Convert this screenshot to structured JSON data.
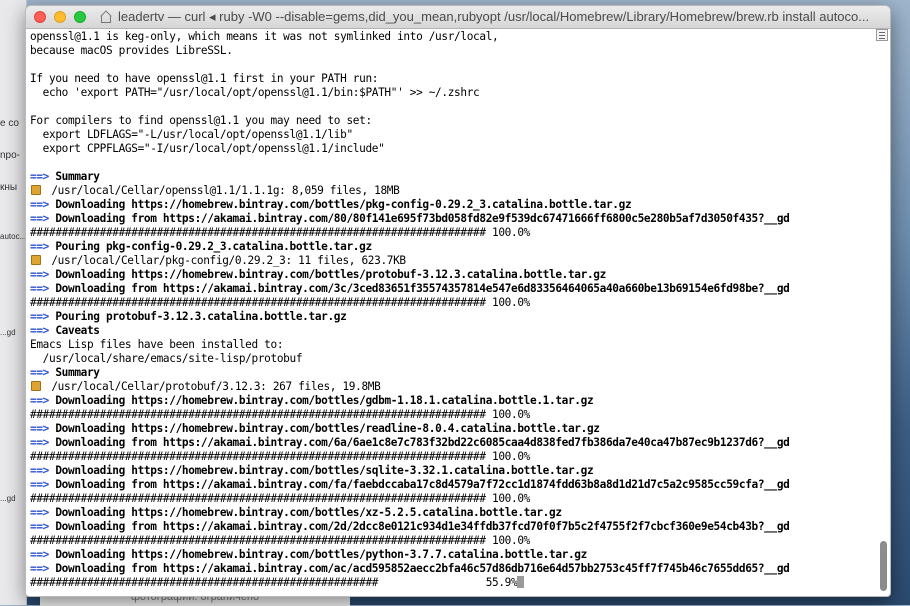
{
  "window": {
    "title": "leadertv — curl ◂ ruby -W0 --disable=gems,did_you_mean,rubyopt /usr/local/Homebrew/Library/Homebrew/brew.rb install autoco...",
    "icon": "house-icon"
  },
  "background": {
    "fragments": [
      "e co",
      "npo-",
      "кны",
      "autoc...",
      "...gd",
      "...gd"
    ],
    "bottom_text": "фотографии: ограничено"
  },
  "terminal": {
    "lines": [
      {
        "parts": [
          {
            "t": "openssl@1.1 is keg-only, which means it was not symlinked into /usr/local,"
          }
        ]
      },
      {
        "parts": [
          {
            "t": "because macOS provides LibreSSL."
          }
        ]
      },
      {
        "parts": [
          {
            "t": ""
          }
        ]
      },
      {
        "parts": [
          {
            "t": "If you need to have openssl@1.1 first in your PATH run:"
          }
        ]
      },
      {
        "parts": [
          {
            "t": "  echo 'export PATH=\"/usr/local/opt/openssl@1.1/bin:$PATH\"' >> ~/.zshrc"
          }
        ]
      },
      {
        "parts": [
          {
            "t": ""
          }
        ]
      },
      {
        "parts": [
          {
            "t": "For compilers to find openssl@1.1 you may need to set:"
          }
        ]
      },
      {
        "parts": [
          {
            "t": "  export LDFLAGS=\"-L/usr/local/opt/openssl@1.1/lib\""
          }
        ]
      },
      {
        "parts": [
          {
            "t": "  export CPPFLAGS=\"-I/usr/local/opt/openssl@1.1/include\""
          }
        ]
      },
      {
        "parts": [
          {
            "t": ""
          }
        ]
      },
      {
        "parts": [
          {
            "t": "==>",
            "c": "arrow"
          },
          {
            "t": " Summary",
            "c": "b"
          }
        ]
      },
      {
        "parts": [
          {
            "beer": true
          },
          {
            "t": " /usr/local/Cellar/openssl@1.1/1.1.1g: 8,059 files, 18MB"
          }
        ]
      },
      {
        "parts": [
          {
            "t": "==>",
            "c": "arrow"
          },
          {
            "t": " Downloading https://homebrew.bintray.com/bottles/pkg-config-0.29.2_3.catalina.bottle.tar.gz",
            "c": "b"
          }
        ]
      },
      {
        "parts": [
          {
            "t": "==>",
            "c": "arrow"
          },
          {
            "t": " Downloading from https://akamai.bintray.com/80/80f141e695f73bd058fd82e9f539dc67471666ff6800c5e280b5af7d3050f435?__gd",
            "c": "b"
          }
        ]
      },
      {
        "parts": [
          {
            "t": "######################################################################## 100.0%"
          }
        ]
      },
      {
        "parts": [
          {
            "t": "==>",
            "c": "arrow"
          },
          {
            "t": " Pouring pkg-config-0.29.2_3.catalina.bottle.tar.gz",
            "c": "b"
          }
        ]
      },
      {
        "parts": [
          {
            "beer": true
          },
          {
            "t": " /usr/local/Cellar/pkg-config/0.29.2_3: 11 files, 623.7KB"
          }
        ]
      },
      {
        "parts": [
          {
            "t": "==>",
            "c": "arrow"
          },
          {
            "t": " Downloading https://homebrew.bintray.com/bottles/protobuf-3.12.3.catalina.bottle.tar.gz",
            "c": "b"
          }
        ]
      },
      {
        "parts": [
          {
            "t": "==>",
            "c": "arrow"
          },
          {
            "t": " Downloading from https://akamai.bintray.com/3c/3ced83651f35574357814e547e6d83356464065a40a660be13b69154e6fd98be?__gd",
            "c": "b"
          }
        ]
      },
      {
        "parts": [
          {
            "t": "######################################################################## 100.0%"
          }
        ]
      },
      {
        "parts": [
          {
            "t": "==>",
            "c": "arrow"
          },
          {
            "t": " Pouring protobuf-3.12.3.catalina.bottle.tar.gz",
            "c": "b"
          }
        ]
      },
      {
        "parts": [
          {
            "t": "==>",
            "c": "arrow"
          },
          {
            "t": " Caveats",
            "c": "b"
          }
        ]
      },
      {
        "parts": [
          {
            "t": "Emacs Lisp files have been installed to:"
          }
        ]
      },
      {
        "parts": [
          {
            "t": "  /usr/local/share/emacs/site-lisp/protobuf"
          }
        ]
      },
      {
        "parts": [
          {
            "t": "==>",
            "c": "arrow"
          },
          {
            "t": " Summary",
            "c": "b"
          }
        ]
      },
      {
        "parts": [
          {
            "beer": true
          },
          {
            "t": " /usr/local/Cellar/protobuf/3.12.3: 267 files, 19.8MB"
          }
        ]
      },
      {
        "parts": [
          {
            "t": "==>",
            "c": "arrow"
          },
          {
            "t": " Downloading https://homebrew.bintray.com/bottles/gdbm-1.18.1.catalina.bottle.1.tar.gz",
            "c": "b"
          }
        ]
      },
      {
        "parts": [
          {
            "t": "######################################################################## 100.0%"
          }
        ]
      },
      {
        "parts": [
          {
            "t": "==>",
            "c": "arrow"
          },
          {
            "t": " Downloading https://homebrew.bintray.com/bottles/readline-8.0.4.catalina.bottle.tar.gz",
            "c": "b"
          }
        ]
      },
      {
        "parts": [
          {
            "t": "==>",
            "c": "arrow"
          },
          {
            "t": " Downloading from https://akamai.bintray.com/6a/6ae1c8e7c783f32bd22c6085caa4d838fed7fb386da7e40ca47b87ec9b1237d6?__gd",
            "c": "b"
          }
        ]
      },
      {
        "parts": [
          {
            "t": "######################################################################## 100.0%"
          }
        ]
      },
      {
        "parts": [
          {
            "t": "==>",
            "c": "arrow"
          },
          {
            "t": " Downloading https://homebrew.bintray.com/bottles/sqlite-3.32.1.catalina.bottle.tar.gz",
            "c": "b"
          }
        ]
      },
      {
        "parts": [
          {
            "t": "==>",
            "c": "arrow"
          },
          {
            "t": " Downloading from https://akamai.bintray.com/fa/faebdccaba17c8d4579a7f72cc1d1874fdd63b8a8d1d21d7c5a2c9585cc59cfa?__gd",
            "c": "b"
          }
        ]
      },
      {
        "parts": [
          {
            "t": "######################################################################## 100.0%"
          }
        ]
      },
      {
        "parts": [
          {
            "t": "==>",
            "c": "arrow"
          },
          {
            "t": " Downloading https://homebrew.bintray.com/bottles/xz-5.2.5.catalina.bottle.tar.gz",
            "c": "b"
          }
        ]
      },
      {
        "parts": [
          {
            "t": "==>",
            "c": "arrow"
          },
          {
            "t": " Downloading from https://akamai.bintray.com/2d/2dcc8e0121c934d1e34ffdb37fcd70f0f7b5c2f4755f2f7cbcf360e9e54cb43b?__gd",
            "c": "b"
          }
        ]
      },
      {
        "parts": [
          {
            "t": "######################################################################## 100.0%"
          }
        ]
      },
      {
        "parts": [
          {
            "t": "==>",
            "c": "arrow"
          },
          {
            "t": " Downloading https://homebrew.bintray.com/bottles/python-3.7.7.catalina.bottle.tar.gz",
            "c": "b"
          }
        ]
      },
      {
        "parts": [
          {
            "t": "==>",
            "c": "arrow"
          },
          {
            "t": " Downloading from https://akamai.bintray.com/ac/acd595852aecc2bfa46c57d86db716e64d57bb2753c45ff7f745b46c7655dd65?__gd",
            "c": "b"
          }
        ]
      },
      {
        "parts": [
          {
            "t": "#######################################################                 55.9%"
          },
          {
            "cursor": true
          }
        ]
      }
    ],
    "download_progress_percent": 55.9
  },
  "colors": {
    "arrow": "#2a4fd6",
    "background_blue": "#3d5f86"
  }
}
